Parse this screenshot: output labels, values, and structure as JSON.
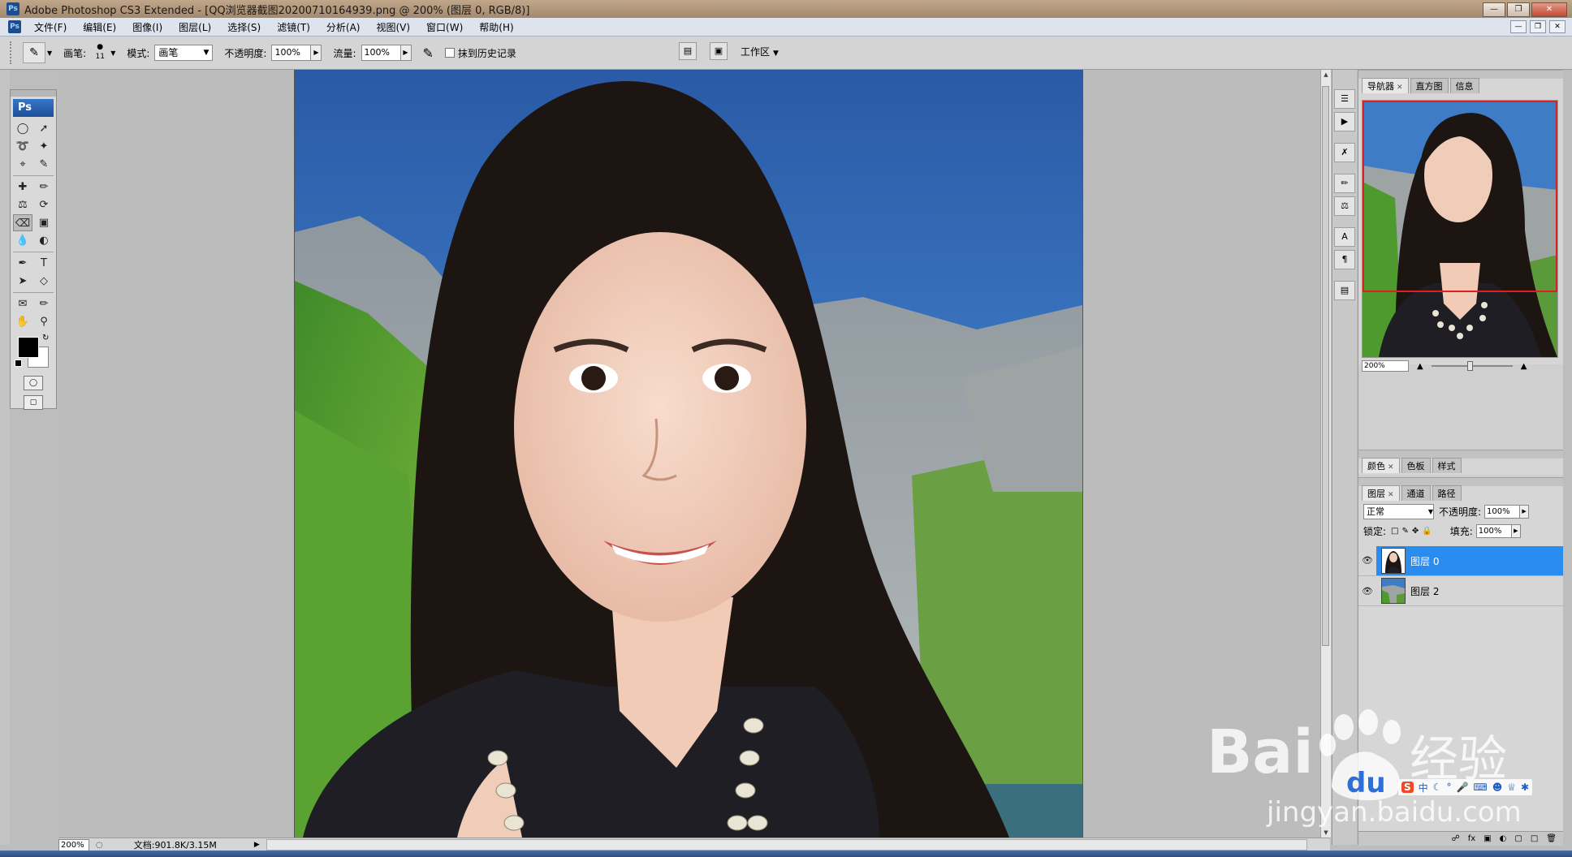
{
  "window": {
    "title": "Adobe Photoshop CS3 Extended - [QQ浏览器截图20200710164939.png @ 200% (图层 0, RGB/8)]",
    "app_icon": "Ps",
    "controls": [
      "minimize-icon",
      "restore-icon",
      "close-icon"
    ]
  },
  "menu": {
    "items": [
      "文件(F)",
      "编辑(E)",
      "图像(I)",
      "图层(L)",
      "选择(S)",
      "滤镜(T)",
      "分析(A)",
      "视图(V)",
      "窗口(W)",
      "帮助(H)"
    ]
  },
  "options": {
    "brush_label": "画笔:",
    "brush_size": "11",
    "mode_label": "模式:",
    "mode_value": "画笔",
    "opacity_label": "不透明度:",
    "opacity_value": "100%",
    "flow_label": "流量:",
    "flow_value": "100%",
    "erase_history_label": "抹到历史记录",
    "workspace_label": "工作区"
  },
  "toolbox": {
    "logo": "Ps",
    "tools": [
      "marquee-icon",
      "move-icon",
      "lasso-icon",
      "magic-wand-icon",
      "crop-icon",
      "slice-icon",
      "healing-icon",
      "brush-icon",
      "clone-stamp-icon",
      "history-brush-icon",
      "eraser-icon",
      "gradient-icon",
      "blur-icon",
      "dodge-icon",
      "pen-icon",
      "type-icon",
      "path-select-icon",
      "shape-icon",
      "notes-icon",
      "eyedropper-icon",
      "hand-icon",
      "zoom-icon"
    ],
    "active_tool": "eraser-icon",
    "foreground_color": "#000000",
    "background_color": "#ffffff"
  },
  "status": {
    "zoom": "200%",
    "doc_info": "文档:901.8K/3.15M"
  },
  "navigator": {
    "tabs": [
      "导航器",
      "直方图",
      "信息"
    ],
    "zoom": "200%"
  },
  "color_panel": {
    "tabs": [
      "颜色",
      "色板",
      "样式"
    ]
  },
  "layers_panel": {
    "tabs": [
      "图层",
      "通道",
      "路径"
    ],
    "blend_mode": "正常",
    "opacity_label": "不透明度:",
    "opacity_value": "100%",
    "lock_label": "锁定:",
    "fill_label": "填充:",
    "fill_value": "100%",
    "layers": [
      {
        "name": "图层 0",
        "selected": true
      },
      {
        "name": "图层 2",
        "selected": false
      }
    ]
  },
  "watermark": {
    "brand": "Baidu经验",
    "url": "jingyan.baidu.com"
  },
  "ime": {
    "logo": "S",
    "lang": "中"
  },
  "colors": {
    "selection_blue": "#2b8cf0",
    "nav_frame_red": "#e02020"
  }
}
